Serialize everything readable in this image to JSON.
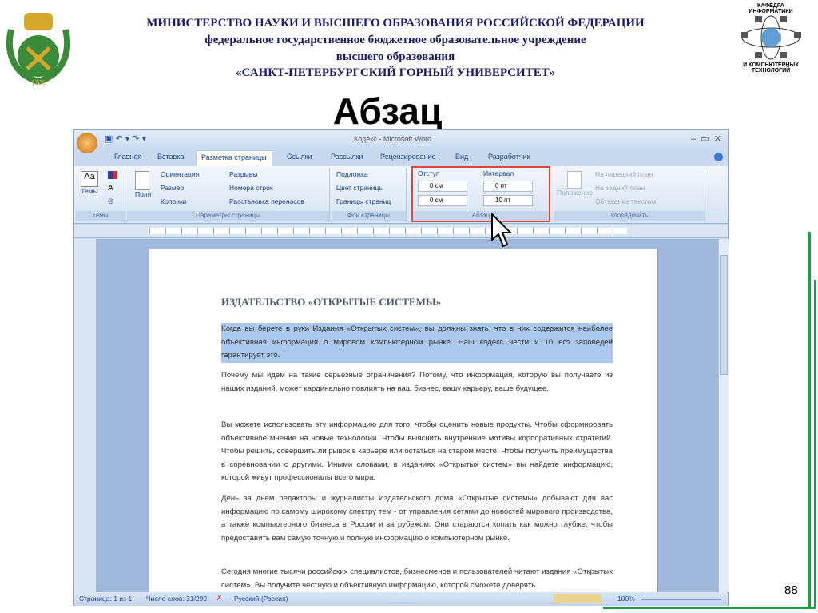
{
  "header": {
    "line1": "МИНИСТЕРСТВО НАУКИ И ВЫСШЕГО ОБРАЗОВАНИЯ РОССИЙСКОЙ ФЕДЕРАЦИИ",
    "line2": "федеральное государственное бюджетное образовательное учреждение",
    "line3": "высшего образования",
    "line4": "«САНКТ-ПЕТЕРБУРГСКИЙ ГОРНЫЙ УНИВЕРСИТЕТ»"
  },
  "logo_left": {
    "year": "1773"
  },
  "logo_right": {
    "top": "КАФЕДРА ИНФОРМАТИКИ",
    "bottom": "И КОМПЬЮТЕРНЫХ ТЕХНОЛОГИЙ"
  },
  "slide_title": "Абзац",
  "page_number": "88",
  "word": {
    "title": "Кодекс - Microsoft Word",
    "tabs": [
      "Главная",
      "Вставка",
      "Разметка страницы",
      "Ссылки",
      "Рассылки",
      "Рецензирование",
      "Вид",
      "Разработчик"
    ],
    "ribbon": {
      "themes": {
        "button": "Темы",
        "group": "Темы"
      },
      "page_setup": {
        "fields": "Поля",
        "orientation": "Ориентация",
        "size": "Размер",
        "columns": "Колонки",
        "breaks": "Разрывы",
        "line_numbers": "Номера строк",
        "hyphenation": "Расстановка переносов",
        "group": "Параметры страницы"
      },
      "background": {
        "watermark": "Подложка",
        "page_color": "Цвет страницы",
        "page_borders": "Границы страниц",
        "group": "Фон страницы"
      },
      "paragraph": {
        "indent_label": "Отступ",
        "spacing_label": "Интервал",
        "indent_left": "0 см",
        "indent_right": "0 см",
        "spacing_before": "0 пт",
        "spacing_after": "10 пт",
        "group": "Абзац"
      },
      "arrange": {
        "position": "Положение",
        "bring_front": "На передний план",
        "send_back": "На задний план",
        "wrap": "Обтекание текстом",
        "group": "Упорядочить"
      }
    },
    "document": {
      "heading": "ИЗДАТЕЛЬСТВО «ОТКРЫТЫЕ СИСТЕМЫ»",
      "paragraphs": [
        "Когда вы берете в руки Издания «Открытых систем», вы должны знать, что в них содержится наиболее объективная информация о мировом компьютерном рынке. Наш кодекс чести и 10 его заповедей гарантирует это.",
        "Почему мы идем на такие серьезные ограничения? Потому, что информация, которую вы получаете из наших изданий, может кардинально повлиять на ваш бизнес, вашу карьеру, ваше будущее.",
        "Вы можете использовать эту информацию для того, чтобы оценить новые продукты. Чтобы сформировать объективное мнение на новые технологии. Чтобы выяснить внутренние мотивы корпоративных стратегий. Чтобы решить, совершить ли рывок в карьере или остаться на старом месте. Чтобы получить преимущества в соревновании с другими. Иными словами, в изданиях «Открытых систем» вы найдете информацию, которой живут профессионалы всего мира.",
        "День за днем редакторы и журналисты Издательского дома «Открытые системы» добывают для вас информацию по самому широкому спектру тем - от управления сетями до новостей мирового производства, а также компьютерного бизнеса в России и за рубежом. Они стараются копать как можно глубже, чтобы предоставить вам самую точную и полную информацию о компьютерном рынке.",
        "Сегодня многие тысячи российских специалистов, бизнесменов и пользователей читают издания «Открытых систем». Вы получите честную и объективную информацию, которой сможете доверять."
      ]
    },
    "status": {
      "page": "Страница: 1 из 1",
      "words": "Число слов: 31/299",
      "language": "Русский (Россия)",
      "zoom": "100%"
    }
  }
}
